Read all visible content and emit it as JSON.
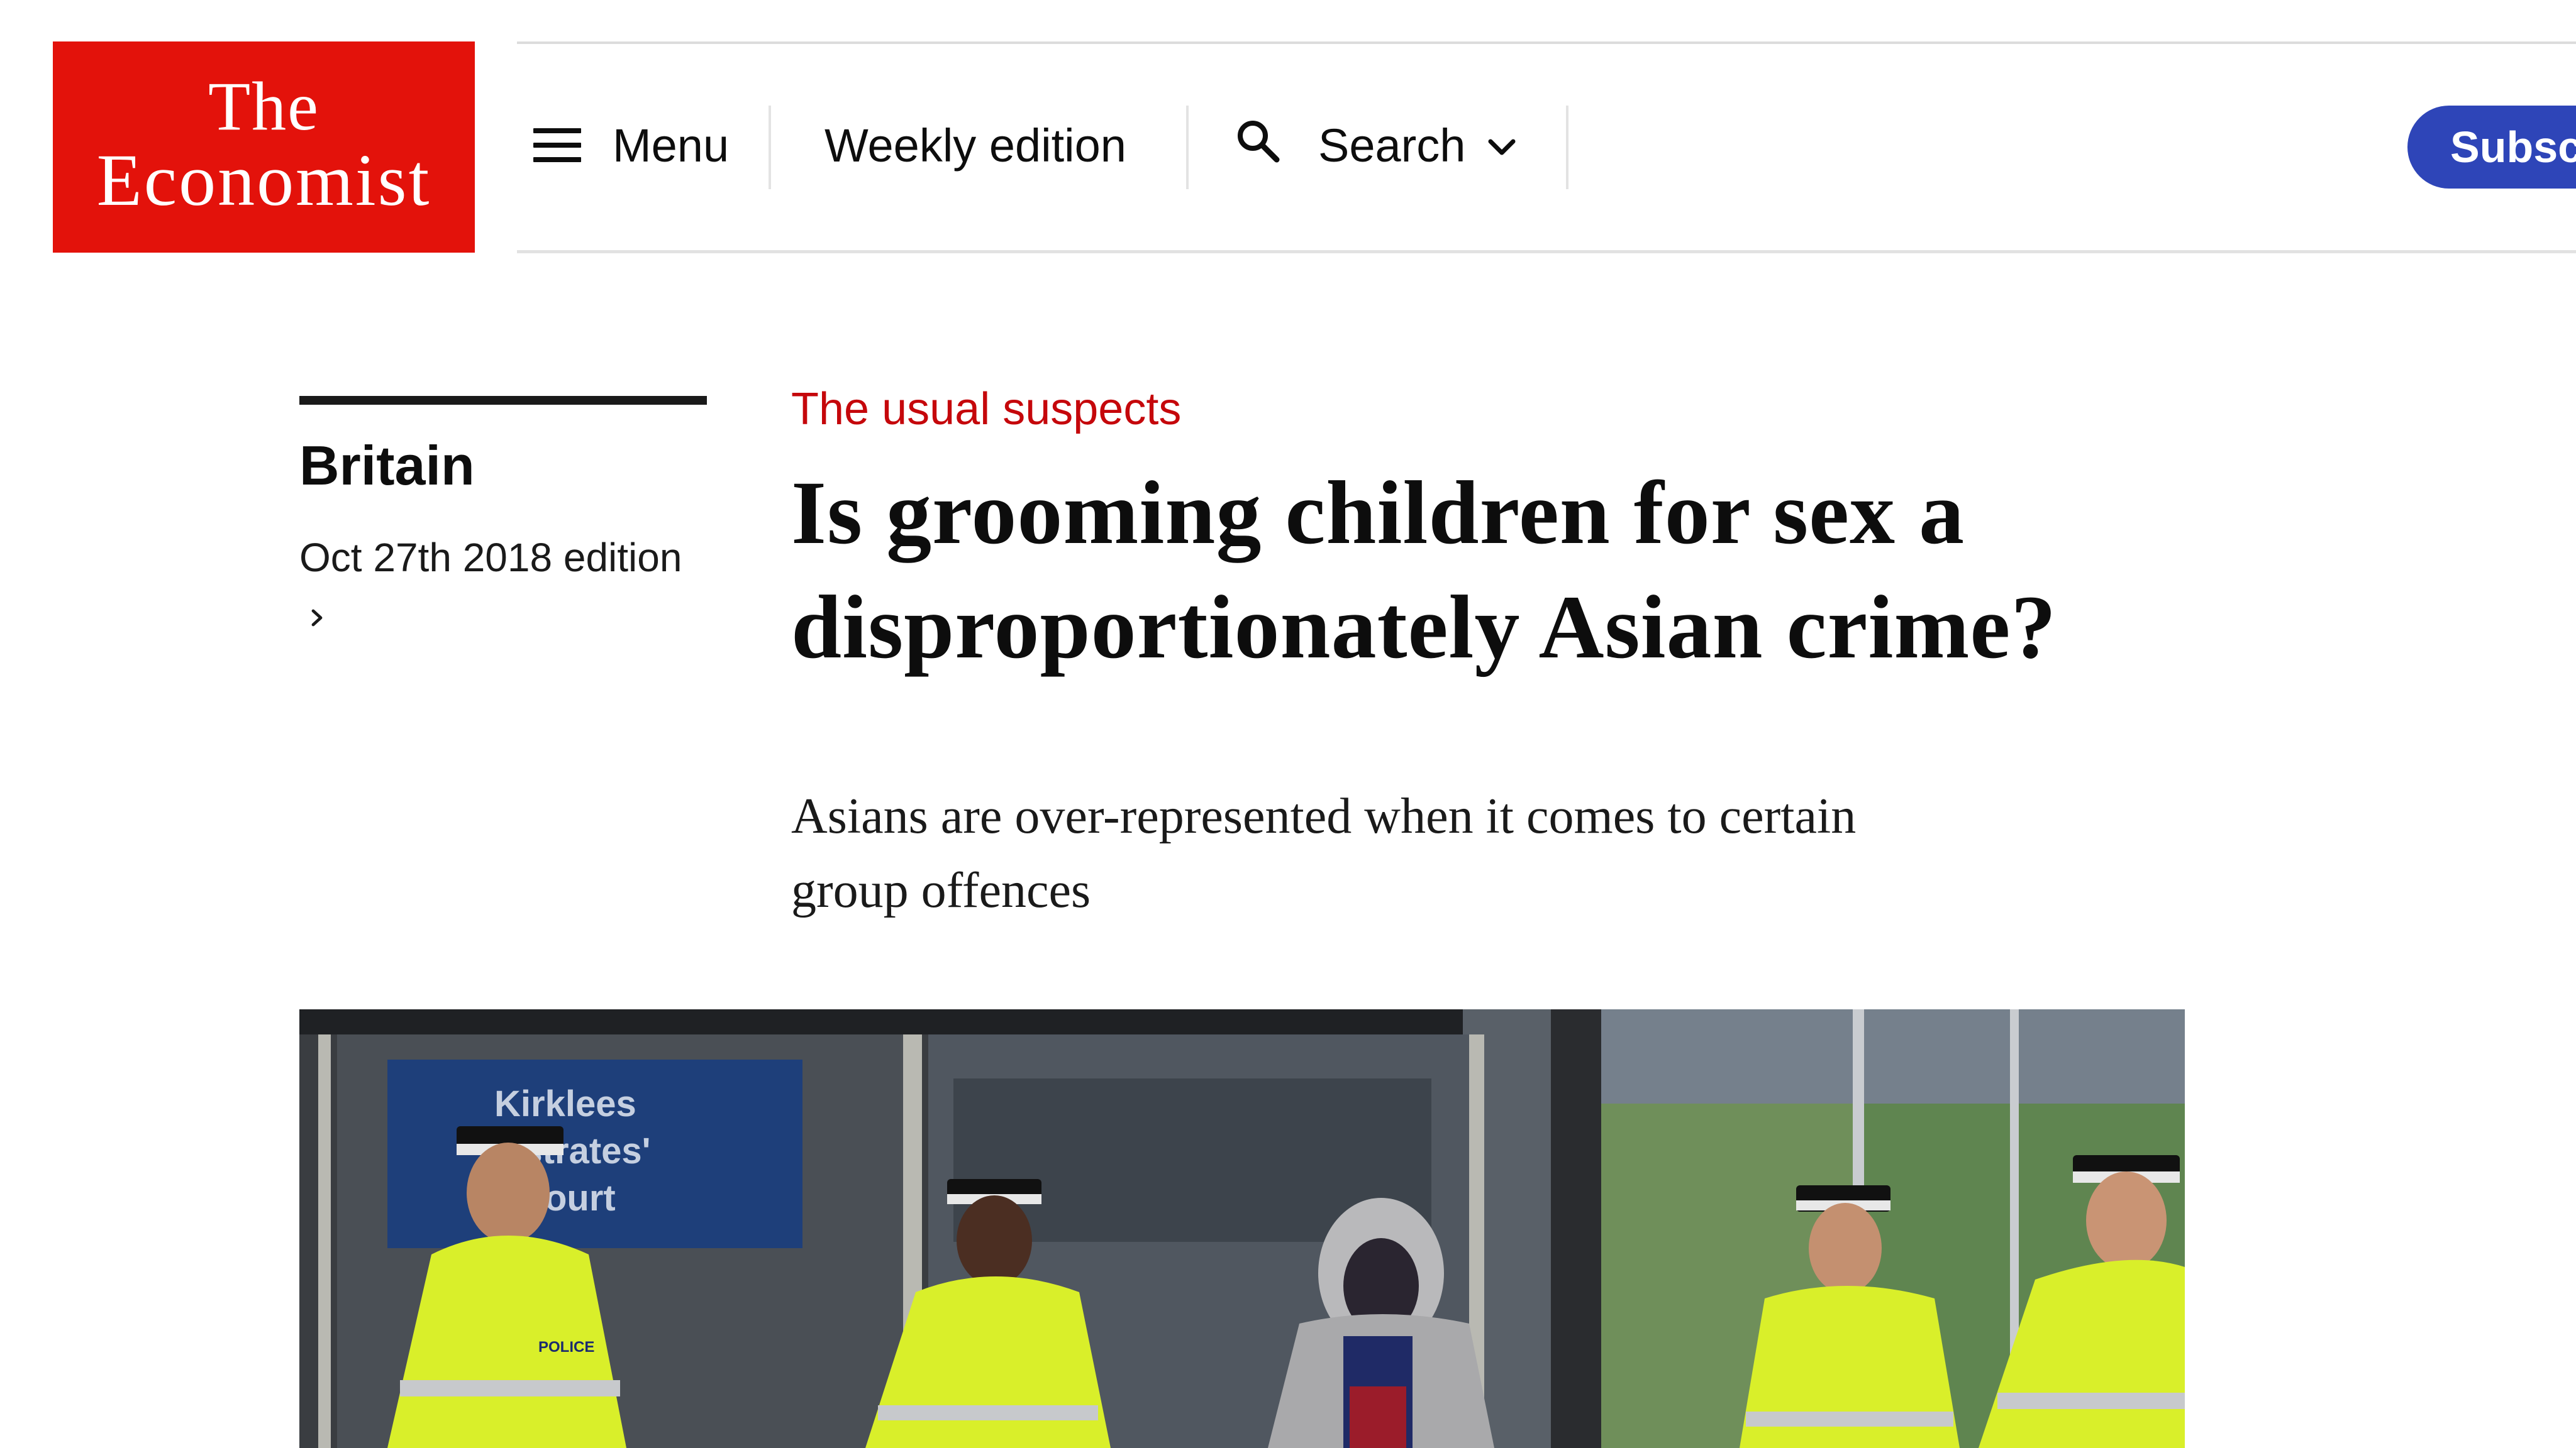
{
  "header": {
    "logo": {
      "line1": "The",
      "line2": "Economist"
    },
    "menu_label": "Menu",
    "weekly_edition_label": "Weekly edition",
    "search_label": "Search",
    "subscribe_label": "Subscr"
  },
  "sidebar": {
    "section": "Britain",
    "edition": "Oct 27th 2018 edition"
  },
  "article": {
    "rubric": "The usual suspects",
    "headline_line1": "Is grooming children for sex a",
    "headline_line2": "disproportionately Asian crime?",
    "standfirst_line1": "Asians are over-represented when it comes to certain",
    "standfirst_line2": "group offences"
  },
  "photo": {
    "sign_line1": "Kirklees",
    "sign_line2": "M  strates'",
    "sign_line3": "ourt",
    "vest_text": "POLICE"
  },
  "icons": [
    "hamburger-icon",
    "search-icon",
    "chevron-down-icon",
    "chevron-right-icon"
  ],
  "colors": {
    "brand_red": "#e3120b",
    "rubric_red": "#c5070b",
    "subscribe_blue": "#2e45b8",
    "hi_vis": "#d9ef2a"
  }
}
